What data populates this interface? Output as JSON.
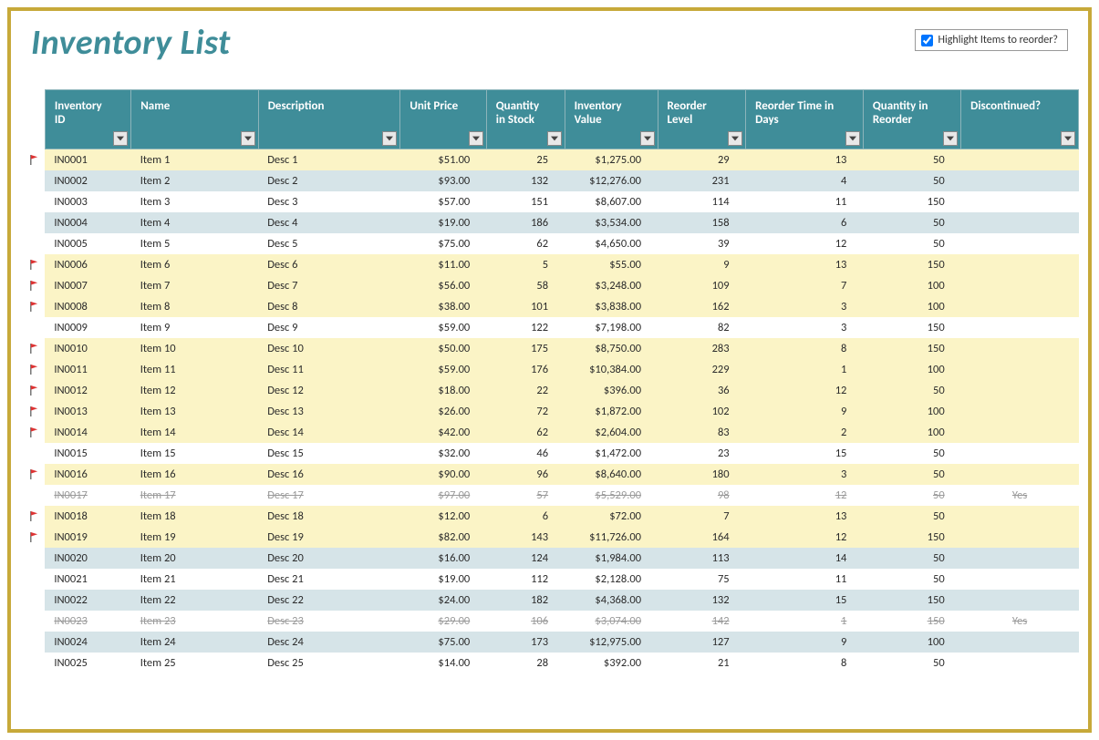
{
  "title": "Inventory List",
  "highlightLabel": "Highlight Items to reorder?",
  "highlightChecked": true,
  "columns": [
    "Inventory ID",
    "Name",
    "Description",
    "Unit Price",
    "Quantity in Stock",
    "Inventory Value",
    "Reorder Level",
    "Reorder Time in Days",
    "Quantity in Reorder",
    "Discontinued?"
  ],
  "rows": [
    {
      "flag": true,
      "highlight": true,
      "id": "IN0001",
      "name": "Item 1",
      "desc": "Desc 1",
      "price": "$51.00",
      "qty": "25",
      "value": "$1,275.00",
      "rl": "29",
      "rt": "13",
      "qr": "50",
      "disc": ""
    },
    {
      "flag": false,
      "highlight": false,
      "id": "IN0002",
      "name": "Item 2",
      "desc": "Desc 2",
      "price": "$93.00",
      "qty": "132",
      "value": "$12,276.00",
      "rl": "231",
      "rt": "4",
      "qr": "50",
      "disc": ""
    },
    {
      "flag": false,
      "highlight": false,
      "id": "IN0003",
      "name": "Item 3",
      "desc": "Desc 3",
      "price": "$57.00",
      "qty": "151",
      "value": "$8,607.00",
      "rl": "114",
      "rt": "11",
      "qr": "150",
      "disc": ""
    },
    {
      "flag": false,
      "highlight": false,
      "id": "IN0004",
      "name": "Item 4",
      "desc": "Desc 4",
      "price": "$19.00",
      "qty": "186",
      "value": "$3,534.00",
      "rl": "158",
      "rt": "6",
      "qr": "50",
      "disc": ""
    },
    {
      "flag": false,
      "highlight": false,
      "id": "IN0005",
      "name": "Item 5",
      "desc": "Desc 5",
      "price": "$75.00",
      "qty": "62",
      "value": "$4,650.00",
      "rl": "39",
      "rt": "12",
      "qr": "50",
      "disc": ""
    },
    {
      "flag": true,
      "highlight": true,
      "id": "IN0006",
      "name": "Item 6",
      "desc": "Desc 6",
      "price": "$11.00",
      "qty": "5",
      "value": "$55.00",
      "rl": "9",
      "rt": "13",
      "qr": "150",
      "disc": ""
    },
    {
      "flag": true,
      "highlight": true,
      "id": "IN0007",
      "name": "Item 7",
      "desc": "Desc 7",
      "price": "$56.00",
      "qty": "58",
      "value": "$3,248.00",
      "rl": "109",
      "rt": "7",
      "qr": "100",
      "disc": ""
    },
    {
      "flag": true,
      "highlight": true,
      "id": "IN0008",
      "name": "Item 8",
      "desc": "Desc 8",
      "price": "$38.00",
      "qty": "101",
      "value": "$3,838.00",
      "rl": "162",
      "rt": "3",
      "qr": "100",
      "disc": ""
    },
    {
      "flag": false,
      "highlight": false,
      "id": "IN0009",
      "name": "Item 9",
      "desc": "Desc 9",
      "price": "$59.00",
      "qty": "122",
      "value": "$7,198.00",
      "rl": "82",
      "rt": "3",
      "qr": "150",
      "disc": ""
    },
    {
      "flag": true,
      "highlight": true,
      "id": "IN0010",
      "name": "Item 10",
      "desc": "Desc 10",
      "price": "$50.00",
      "qty": "175",
      "value": "$8,750.00",
      "rl": "283",
      "rt": "8",
      "qr": "150",
      "disc": ""
    },
    {
      "flag": true,
      "highlight": true,
      "id": "IN0011",
      "name": "Item 11",
      "desc": "Desc 11",
      "price": "$59.00",
      "qty": "176",
      "value": "$10,384.00",
      "rl": "229",
      "rt": "1",
      "qr": "100",
      "disc": ""
    },
    {
      "flag": true,
      "highlight": true,
      "id": "IN0012",
      "name": "Item 12",
      "desc": "Desc 12",
      "price": "$18.00",
      "qty": "22",
      "value": "$396.00",
      "rl": "36",
      "rt": "12",
      "qr": "50",
      "disc": ""
    },
    {
      "flag": true,
      "highlight": true,
      "id": "IN0013",
      "name": "Item 13",
      "desc": "Desc 13",
      "price": "$26.00",
      "qty": "72",
      "value": "$1,872.00",
      "rl": "102",
      "rt": "9",
      "qr": "100",
      "disc": ""
    },
    {
      "flag": true,
      "highlight": true,
      "id": "IN0014",
      "name": "Item 14",
      "desc": "Desc 14",
      "price": "$42.00",
      "qty": "62",
      "value": "$2,604.00",
      "rl": "83",
      "rt": "2",
      "qr": "100",
      "disc": ""
    },
    {
      "flag": false,
      "highlight": false,
      "id": "IN0015",
      "name": "Item 15",
      "desc": "Desc 15",
      "price": "$32.00",
      "qty": "46",
      "value": "$1,472.00",
      "rl": "23",
      "rt": "15",
      "qr": "50",
      "disc": ""
    },
    {
      "flag": true,
      "highlight": true,
      "id": "IN0016",
      "name": "Item 16",
      "desc": "Desc 16",
      "price": "$90.00",
      "qty": "96",
      "value": "$8,640.00",
      "rl": "180",
      "rt": "3",
      "qr": "50",
      "disc": ""
    },
    {
      "flag": false,
      "highlight": false,
      "id": "IN0017",
      "name": "Item 17",
      "desc": "Desc 17",
      "price": "$97.00",
      "qty": "57",
      "value": "$5,529.00",
      "rl": "98",
      "rt": "12",
      "qr": "50",
      "disc": "Yes",
      "discontinued": true
    },
    {
      "flag": true,
      "highlight": true,
      "id": "IN0018",
      "name": "Item 18",
      "desc": "Desc 18",
      "price": "$12.00",
      "qty": "6",
      "value": "$72.00",
      "rl": "7",
      "rt": "13",
      "qr": "50",
      "disc": ""
    },
    {
      "flag": true,
      "highlight": true,
      "id": "IN0019",
      "name": "Item 19",
      "desc": "Desc 19",
      "price": "$82.00",
      "qty": "143",
      "value": "$11,726.00",
      "rl": "164",
      "rt": "12",
      "qr": "150",
      "disc": ""
    },
    {
      "flag": false,
      "highlight": false,
      "id": "IN0020",
      "name": "Item 20",
      "desc": "Desc 20",
      "price": "$16.00",
      "qty": "124",
      "value": "$1,984.00",
      "rl": "113",
      "rt": "14",
      "qr": "50",
      "disc": ""
    },
    {
      "flag": false,
      "highlight": false,
      "id": "IN0021",
      "name": "Item 21",
      "desc": "Desc 21",
      "price": "$19.00",
      "qty": "112",
      "value": "$2,128.00",
      "rl": "75",
      "rt": "11",
      "qr": "50",
      "disc": ""
    },
    {
      "flag": false,
      "highlight": false,
      "id": "IN0022",
      "name": "Item 22",
      "desc": "Desc 22",
      "price": "$24.00",
      "qty": "182",
      "value": "$4,368.00",
      "rl": "132",
      "rt": "15",
      "qr": "150",
      "disc": ""
    },
    {
      "flag": false,
      "highlight": false,
      "id": "IN0023",
      "name": "Item 23",
      "desc": "Desc 23",
      "price": "$29.00",
      "qty": "106",
      "value": "$3,074.00",
      "rl": "142",
      "rt": "1",
      "qr": "150",
      "disc": "Yes",
      "discontinued": true
    },
    {
      "flag": false,
      "highlight": false,
      "id": "IN0024",
      "name": "Item 24",
      "desc": "Desc 24",
      "price": "$75.00",
      "qty": "173",
      "value": "$12,975.00",
      "rl": "127",
      "rt": "9",
      "qr": "100",
      "disc": ""
    },
    {
      "flag": false,
      "highlight": false,
      "id": "IN0025",
      "name": "Item 25",
      "desc": "Desc 25",
      "price": "$14.00",
      "qty": "28",
      "value": "$392.00",
      "rl": "21",
      "rt": "8",
      "qr": "50",
      "disc": ""
    }
  ]
}
